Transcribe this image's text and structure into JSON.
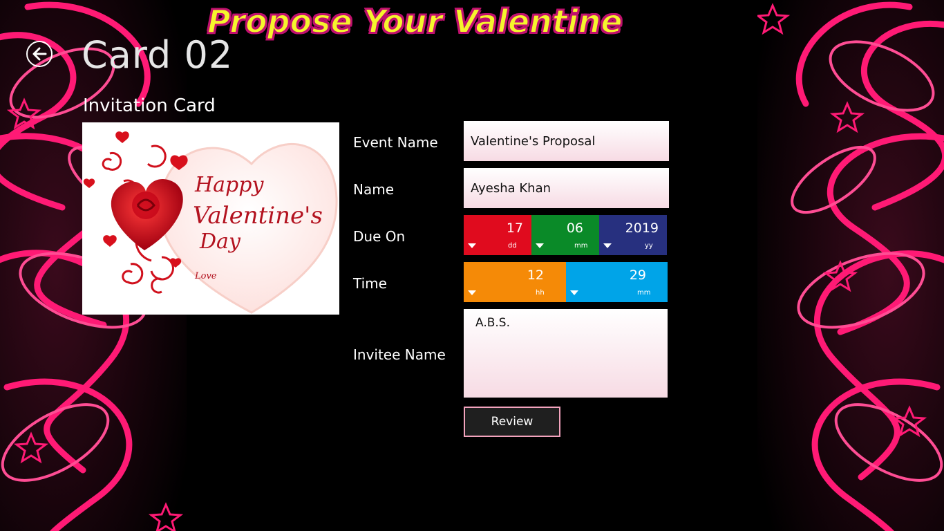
{
  "app": {
    "banner": "Propose Your Valentine",
    "page_title": "Card 02",
    "section_title": "Invitation Card"
  },
  "card_image": {
    "line1": "Happy",
    "line2": "Valentine's",
    "line3": "Day",
    "signature": "Love"
  },
  "form": {
    "event_name_label": "Event Name",
    "event_name_value": "Valentine's Proposal",
    "name_label": "Name",
    "name_value": "Ayesha Khan",
    "due_on_label": "Due On",
    "date": {
      "day": "17",
      "day_unit": "dd",
      "month": "06",
      "month_unit": "mm",
      "year": "2019",
      "year_unit": "yy"
    },
    "time_label": "Time",
    "time": {
      "hour": "12",
      "hour_unit": "hh",
      "minute": "29",
      "minute_unit": "mm"
    },
    "invitee_label": "Invitee Name",
    "invitee_value": "A.B.S.",
    "review_label": "Review"
  },
  "colors": {
    "accent_pink": "#ff1a75",
    "day_bg": "#e00b1e",
    "month_bg": "#0a8a28",
    "year_bg": "#27307f",
    "hour_bg": "#f58a07",
    "minute_bg": "#00a4e8"
  }
}
